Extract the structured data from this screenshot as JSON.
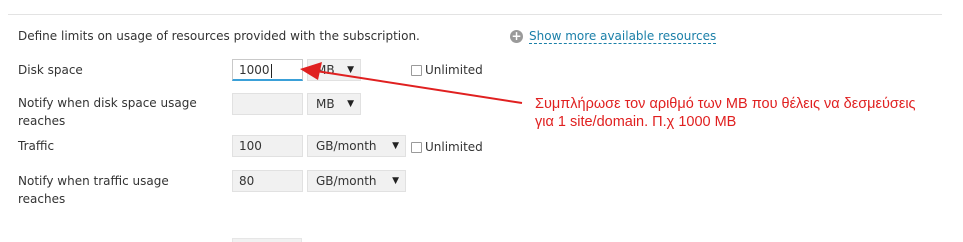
{
  "intro_text": "Define limits on usage of resources provided with the subscription.",
  "more_link": {
    "label": "Show more available resources",
    "icon": "plus-circle-icon"
  },
  "rows": {
    "disk": {
      "label": "Disk space",
      "value": "1000",
      "unit": "MB",
      "unlimited_label": "Unlimited"
    },
    "disk_notify": {
      "label": "Notify when disk space usage reaches",
      "value": "",
      "unit": "MB"
    },
    "traffic": {
      "label": "Traffic",
      "value": "100",
      "unit": "GB/month",
      "unlimited_label": "Unlimited"
    },
    "traffic_notify": {
      "label": "Notify when traffic usage reaches",
      "value": "80",
      "unit": "GB/month"
    }
  },
  "annotation": {
    "line1": "Συμπλήρωσε τον αριθμό των MB που θέλεις να δεσμεύσεις",
    "line2": "για 1 site/domain. Π.χ 1000 MB",
    "color": "#e02020"
  },
  "colors": {
    "link": "#1a7fa8",
    "focus": "#3aa0d8"
  }
}
